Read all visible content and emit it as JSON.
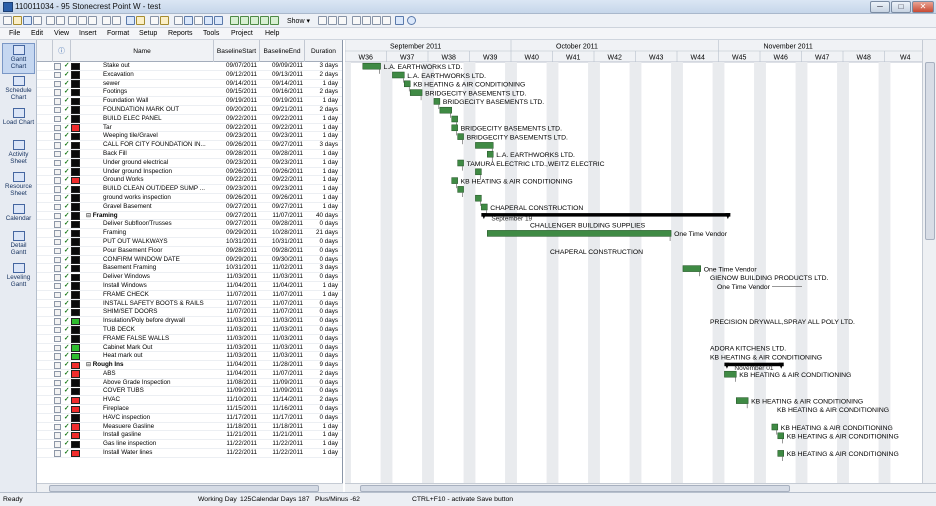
{
  "window": {
    "title": "110011034 - 95 Stonecrest Point W - test",
    "min": "─",
    "max": "□",
    "close": "✕"
  },
  "toolbar": {
    "show_label": "Show ▾"
  },
  "menu": [
    "File",
    "Edit",
    "View",
    "Insert",
    "Format",
    "Setup",
    "Reports",
    "Tools",
    "Project",
    "Help"
  ],
  "sidebar": [
    {
      "label": "Gantt Chart",
      "active": true
    },
    {
      "label": "Schedule Chart",
      "active": false
    },
    {
      "label": "Load Chart",
      "active": false
    },
    {
      "label": "Activity Sheet",
      "active": false
    },
    {
      "label": "Resource Sheet",
      "active": false
    },
    {
      "label": "Calendar",
      "active": false
    },
    {
      "label": "Detail Gantt",
      "active": false
    },
    {
      "label": "Leveling Gantt",
      "active": false
    }
  ],
  "grid": {
    "info_icon": "ⓘ",
    "col_name": "Name",
    "col_bstart": "BaselineStart",
    "col_bend": "BaselineEnd",
    "col_dur": "Duration"
  },
  "timeline": {
    "months": [
      {
        "label": "September 2011",
        "week": 0
      },
      {
        "label": "October 2011",
        "week": 4
      },
      {
        "label": "November 2011",
        "week": 9
      }
    ],
    "weeks": [
      "W36",
      "W37",
      "W38",
      "W39",
      "W40",
      "W41",
      "W42",
      "W43",
      "W44",
      "W45",
      "W46",
      "W47",
      "W48",
      "W4"
    ],
    "start_date": "2011-09-04"
  },
  "colors": {
    "green": "#2fbe2f",
    "red": "#f02c2c",
    "black": "#0a0a0a",
    "bar": "#3f8a44",
    "summary": "#000000"
  },
  "tasks": [
    {
      "name": "Stake out",
      "bs": "09/07/2011",
      "be": "09/09/2011",
      "dur": "3 days",
      "status": "black",
      "gs": "2011-09-07",
      "ge": "2011-09-09",
      "res": "L.A. EARTHWORKS LTD."
    },
    {
      "name": "Excavation",
      "bs": "09/12/2011",
      "be": "09/13/2011",
      "dur": "2 days",
      "status": "black",
      "gs": "2011-09-12",
      "ge": "2011-09-13",
      "res": "L.A. EARTHWORKS LTD."
    },
    {
      "name": "sewer",
      "bs": "09/14/2011",
      "be": "09/14/2011",
      "dur": "1 day",
      "status": "black",
      "gs": "2011-09-14",
      "ge": "2011-09-14",
      "res": "KB HEATING & AIR CONDITIONING"
    },
    {
      "name": "Footings",
      "bs": "09/15/2011",
      "be": "09/16/2011",
      "dur": "2 days",
      "status": "black",
      "gs": "2011-09-15",
      "ge": "2011-09-16",
      "res": "BRIDGECITY BASEMENTS LTD."
    },
    {
      "name": "Foundation Wall",
      "bs": "09/19/2011",
      "be": "09/19/2011",
      "dur": "1 day",
      "status": "black",
      "gs": "2011-09-19",
      "ge": "2011-09-19",
      "res": "BRIDGECITY BASEMENTS LTD."
    },
    {
      "name": "FOUNDATION MARK OUT",
      "bs": "09/20/2011",
      "be": "09/21/2011",
      "dur": "2 days",
      "status": "black",
      "gs": "2011-09-20",
      "ge": "2011-09-21",
      "res": ""
    },
    {
      "name": "BUILD ELEC PANEL",
      "bs": "09/22/2011",
      "be": "09/22/2011",
      "dur": "1 day",
      "status": "black",
      "gs": "2011-09-22",
      "ge": "2011-09-22",
      "res": ""
    },
    {
      "name": "Tar",
      "bs": "09/22/2011",
      "be": "09/22/2011",
      "dur": "1 day",
      "status": "red",
      "gs": "2011-09-22",
      "ge": "2011-09-22",
      "res": "BRIDGECITY BASEMENTS LTD."
    },
    {
      "name": "Weeping tile/Gravel",
      "bs": "09/23/2011",
      "be": "09/23/2011",
      "dur": "1 day",
      "status": "black",
      "gs": "2011-09-23",
      "ge": "2011-09-23",
      "res": "BRIDGECITY BASEMENTS LTD."
    },
    {
      "name": "CALL FOR CITY FOUNDATION IN...",
      "bs": "09/26/2011",
      "be": "09/27/2011",
      "dur": "3 days",
      "status": "black",
      "gs": "2011-09-26",
      "ge": "2011-09-28",
      "res": ""
    },
    {
      "name": "Back Fill",
      "bs": "09/28/2011",
      "be": "09/28/2011",
      "dur": "1 day",
      "status": "black",
      "gs": "2011-09-28",
      "ge": "2011-09-28",
      "res": "L.A. EARTHWORKS LTD."
    },
    {
      "name": "Under ground electrical",
      "bs": "09/23/2011",
      "be": "09/23/2011",
      "dur": "1 day",
      "status": "black",
      "gs": "2011-09-23",
      "ge": "2011-09-23",
      "res": "TAMURA ELECTRIC LTD.,WEITZ ELECTRIC"
    },
    {
      "name": "Under ground Inspection",
      "bs": "09/26/2011",
      "be": "09/26/2011",
      "dur": "1 day",
      "status": "black",
      "gs": "2011-09-26",
      "ge": "2011-09-26",
      "res": ""
    },
    {
      "name": "Ground Works",
      "bs": "09/22/2011",
      "be": "09/22/2011",
      "dur": "1 day",
      "status": "red",
      "gs": "2011-09-22",
      "ge": "2011-09-22",
      "res": "KB HEATING & AIR CONDITIONING"
    },
    {
      "name": "BUILD CLEAN OUT/DEEP SUMP ...",
      "bs": "09/23/2011",
      "be": "09/23/2011",
      "dur": "1 day",
      "status": "black",
      "gs": "2011-09-23",
      "ge": "2011-09-23",
      "res": ""
    },
    {
      "name": "ground works inspection",
      "bs": "09/26/2011",
      "be": "09/26/2011",
      "dur": "1 day",
      "status": "black",
      "gs": "2011-09-26",
      "ge": "2011-09-26",
      "res": ""
    },
    {
      "name": "Gravel Basement",
      "bs": "09/27/2011",
      "be": "09/27/2011",
      "dur": "1 day",
      "status": "black",
      "gs": "2011-09-27",
      "ge": "2011-09-27",
      "res": "CHAPERAL CONSTRUCTION"
    },
    {
      "name": "Framing",
      "bs": "09/27/2011",
      "be": "11/07/2011",
      "dur": "40 days",
      "status": "black",
      "gs": "2011-09-27",
      "ge": "2011-11-07",
      "res": "",
      "summary": true,
      "date_label": "September 19"
    },
    {
      "name": "Deliver Subfloor/Trusses",
      "bs": "09/27/2011",
      "be": "09/28/2011",
      "dur": "0 days",
      "status": "black",
      "gs": "",
      "ge": "",
      "res": "CHALLENGER BUILDING SUPPLIES"
    },
    {
      "name": "Framing",
      "bs": "09/29/2011",
      "be": "10/28/2011",
      "dur": "21 days",
      "status": "black",
      "gs": "2011-09-28",
      "ge": "2011-10-28",
      "res": "One Time Vendor"
    },
    {
      "name": "PUT OUT WALKWAYS",
      "bs": "10/31/2011",
      "be": "10/31/2011",
      "dur": "0 days",
      "status": "black",
      "gs": "",
      "ge": "",
      "res": ""
    },
    {
      "name": "Pour Basement Floor",
      "bs": "09/28/2011",
      "be": "09/28/2011",
      "dur": "0 days",
      "status": "black",
      "gs": "",
      "ge": "",
      "res": "CHAPERAL CONSTRUCTION"
    },
    {
      "name": "CONFIRM WINDOW DATE",
      "bs": "09/29/2011",
      "be": "09/30/2011",
      "dur": "0 days",
      "status": "black",
      "gs": "",
      "ge": "",
      "res": ""
    },
    {
      "name": "Basement Framing",
      "bs": "10/31/2011",
      "be": "11/02/2011",
      "dur": "3 days",
      "status": "black",
      "gs": "2011-10-31",
      "ge": "2011-11-02",
      "res": "One Time Vendor"
    },
    {
      "name": "Deliver Windows",
      "bs": "11/03/2011",
      "be": "11/03/2011",
      "dur": "0 days",
      "status": "black",
      "gs": "",
      "ge": "",
      "res": "GIENOW BUILDING PRODUCTS LTD."
    },
    {
      "name": "Install Windows",
      "bs": "11/04/2011",
      "be": "11/04/2011",
      "dur": "1 day",
      "status": "black",
      "gs": "",
      "ge": "",
      "res": "One Time Vendor"
    },
    {
      "name": "FRAME CHECK",
      "bs": "11/07/2011",
      "be": "11/07/2011",
      "dur": "1 day",
      "status": "black",
      "gs": "",
      "ge": "",
      "res": ""
    },
    {
      "name": "INSTALL SAFETY BOOTS & RAILS",
      "bs": "11/07/2011",
      "be": "11/07/2011",
      "dur": "0 days",
      "status": "black",
      "gs": "",
      "ge": "",
      "res": ""
    },
    {
      "name": "SHIM/SET DOORS",
      "bs": "11/07/2011",
      "be": "11/07/2011",
      "dur": "0 days",
      "status": "black",
      "gs": "",
      "ge": "",
      "res": ""
    },
    {
      "name": "Insulation/Poly before drywall",
      "bs": "11/03/2011",
      "be": "11/03/2011",
      "dur": "0 days",
      "status": "green",
      "gs": "",
      "ge": "",
      "res": "PRECISION DRYWALL,SPRAY ALL POLY LTD."
    },
    {
      "name": "TUB DECK",
      "bs": "11/03/2011",
      "be": "11/03/2011",
      "dur": "0 days",
      "status": "black",
      "gs": "",
      "ge": "",
      "res": ""
    },
    {
      "name": "FRAME FALSE WALLS",
      "bs": "11/03/2011",
      "be": "11/03/2011",
      "dur": "0 days",
      "status": "black",
      "gs": "",
      "ge": "",
      "res": ""
    },
    {
      "name": "Cabinet Mark Out",
      "bs": "11/03/2011",
      "be": "11/03/2011",
      "dur": "0 days",
      "status": "green",
      "gs": "",
      "ge": "",
      "res": "ADORA KITCHENS LTD."
    },
    {
      "name": "Heat mark out",
      "bs": "11/03/2011",
      "be": "11/03/2011",
      "dur": "0 days",
      "status": "green",
      "gs": "",
      "ge": "",
      "res": "KB HEATING & AIR CONDITIONING"
    },
    {
      "name": "Rough Ins",
      "bs": "11/04/2011",
      "be": "11/28/2011",
      "dur": "9 days",
      "status": "red",
      "gs": "2011-11-07",
      "ge": "2011-11-16",
      "res": "",
      "summary": true,
      "date_label": "November 01"
    },
    {
      "name": "ABS",
      "bs": "11/04/2011",
      "be": "11/07/2011",
      "dur": "2 days",
      "status": "red",
      "gs": "2011-11-07",
      "ge": "2011-11-08",
      "res": "KB HEATING & AIR CONDITIONING"
    },
    {
      "name": "Above Grade Inspection",
      "bs": "11/08/2011",
      "be": "11/09/2011",
      "dur": "0 days",
      "status": "black",
      "gs": "",
      "ge": "",
      "res": ""
    },
    {
      "name": "COVER TUBS",
      "bs": "11/09/2011",
      "be": "11/09/2011",
      "dur": "0 days",
      "status": "black",
      "gs": "",
      "ge": "",
      "res": ""
    },
    {
      "name": "HVAC",
      "bs": "11/10/2011",
      "be": "11/14/2011",
      "dur": "2 days",
      "status": "red",
      "gs": "2011-11-09",
      "ge": "2011-11-10",
      "res": "KB HEATING & AIR CONDITIONING"
    },
    {
      "name": "Fireplace",
      "bs": "11/15/2011",
      "be": "11/16/2011",
      "dur": "0 days",
      "status": "red",
      "gs": "",
      "ge": "",
      "res": "KB HEATING & AIR CONDITIONING"
    },
    {
      "name": "HAVC inspection",
      "bs": "11/17/2011",
      "be": "11/17/2011",
      "dur": "0 days",
      "status": "black",
      "gs": "",
      "ge": "",
      "res": ""
    },
    {
      "name": "Measuere Gasline",
      "bs": "11/18/2011",
      "be": "11/18/2011",
      "dur": "1 day",
      "status": "red",
      "gs": "2011-11-15",
      "ge": "2011-11-15",
      "res": "KB HEATING & AIR CONDITIONING"
    },
    {
      "name": "Install gasline",
      "bs": "11/21/2011",
      "be": "11/21/2011",
      "dur": "1 day",
      "status": "red",
      "gs": "2011-11-16",
      "ge": "2011-11-16",
      "res": "KB HEATING & AIR CONDITIONING"
    },
    {
      "name": "Gas line inspection",
      "bs": "11/22/2011",
      "be": "11/22/2011",
      "dur": "1 day",
      "status": "black",
      "gs": "",
      "ge": "",
      "res": ""
    },
    {
      "name": "Install Water lines",
      "bs": "11/22/2011",
      "be": "11/22/2011",
      "dur": "1 day",
      "status": "red",
      "gs": "2011-11-16",
      "ge": "2011-11-16",
      "res": "KB HEATING & AIR CONDITIONING"
    }
  ],
  "status": {
    "ready": "Ready",
    "workdays": "Working Day",
    "calendar": "125Calendar Days 187",
    "plusminus": "Plus/Minus -62",
    "hint": "CTRL+F10 - activate Save button"
  }
}
